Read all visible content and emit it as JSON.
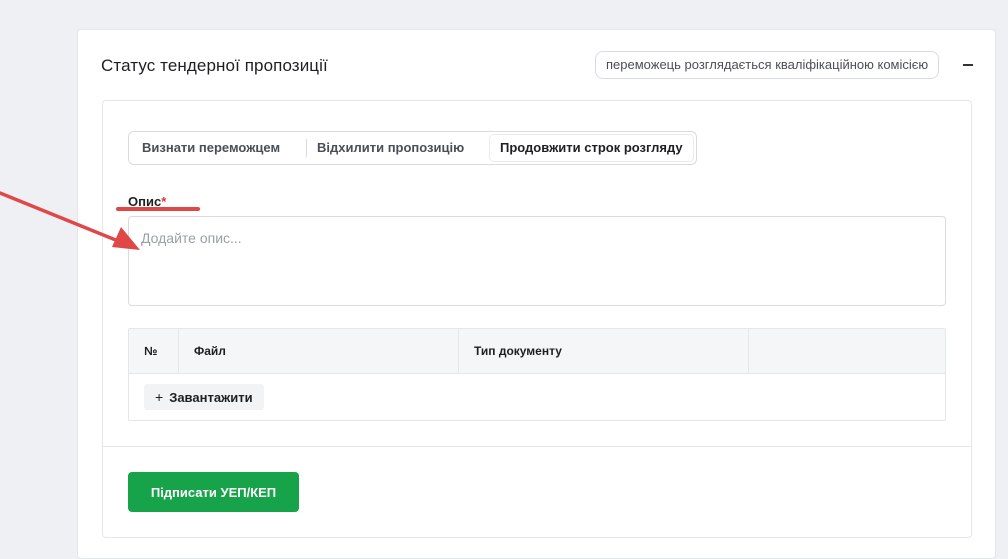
{
  "card": {
    "title": "Статус тендерної пропозиції",
    "status_badge": "переможець розглядається кваліфікаційною комісією"
  },
  "tabs": [
    {
      "label": "Визнати переможцем",
      "active": false
    },
    {
      "label": "Відхилити пропозицію",
      "active": false
    },
    {
      "label": "Продовжити строк розгляду",
      "active": true
    }
  ],
  "description": {
    "label": "Опис",
    "required_mark": "*",
    "placeholder": "Додайте опис...",
    "value": ""
  },
  "documents_table": {
    "headers": [
      "№",
      "Файл",
      "Тип документу",
      ""
    ],
    "upload_label": "Завантажити",
    "upload_icon": "plus-icon"
  },
  "actions": {
    "sign_label": "Підписати УЕП/КЕП"
  },
  "colors": {
    "accent_green": "#16a34a",
    "annotation_red": "#e04848",
    "required_red": "#e03131"
  }
}
